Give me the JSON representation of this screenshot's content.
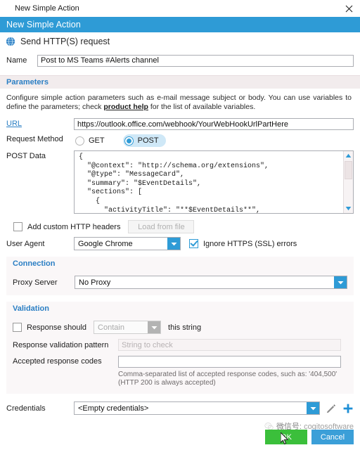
{
  "window": {
    "title": "New Simple Action",
    "close_icon": "close-icon"
  },
  "banner": {
    "title": "New Simple Action"
  },
  "action": {
    "icon": "globe-icon",
    "title": "Send HTTP(S) request"
  },
  "name_field": {
    "label": "Name",
    "value": "Post to MS Teams #Alerts channel"
  },
  "parameters": {
    "header": "Parameters",
    "description_part1": "Configure simple action parameters such as e-mail message subject or body. You can use variables to define the parameters; check ",
    "description_link": "product help",
    "description_part2": " for the list of available variables.",
    "url": {
      "label": "URL",
      "value": "https://outlook.office.com/webhook/YourWebHookUrlPartHere"
    },
    "request_method": {
      "label": "Request Method",
      "options": [
        "GET",
        "POST"
      ],
      "selected": "POST"
    },
    "post_data": {
      "label": "POST Data",
      "value": "{\n  \"@context\": \"http://schema.org/extensions\",\n  \"@type\": \"MessageCard\",\n  \"summary\": \"$EventDetails\",\n  \"sections\": [\n    {\n      \"activityTitle\": \"**$EventDetails**\",",
      "scroll_up_icon": "scroll-up-arrow-icon",
      "scroll_down_icon": "scroll-down-arrow-icon"
    },
    "custom_headers": {
      "label": "Add custom HTTP headers",
      "checked": false,
      "load_button": "Load from file",
      "load_button_enabled": false
    },
    "user_agent": {
      "label": "User Agent",
      "value": "Google Chrome"
    },
    "ignore_ssl": {
      "label": "Ignore HTTPS (SSL) errors",
      "checked": true
    }
  },
  "connection": {
    "header": "Connection",
    "proxy": {
      "label": "Proxy Server",
      "value": "No Proxy"
    }
  },
  "validation": {
    "header": "Validation",
    "response_should": {
      "label": "Response should",
      "checked": false,
      "condition": "Contain",
      "tail": "this string"
    },
    "pattern": {
      "label": "Response validation pattern",
      "placeholder": "String to check",
      "value": ""
    },
    "accepted_codes": {
      "label": "Accepted response codes",
      "value": "",
      "hint": "Comma-separated list of accepted response codes, such as: '404,500' (HTTP 200 is always accepted)"
    }
  },
  "credentials": {
    "label": "Credentials",
    "value": "<Empty credentials>",
    "edit_icon": "pencil-icon",
    "add_icon": "plus-icon"
  },
  "footer": {
    "ok_label": "OK",
    "cancel_label": "Cancel"
  },
  "watermark": {
    "prefix": "微信号:",
    "handle": "cogitosoftware"
  },
  "colors": {
    "banner_blue": "#2e9bd6",
    "section_header_text": "#2b7fc4",
    "section_header_bg": "#f2eced",
    "ok_green": "#3bbf3b",
    "cancel_blue": "#3b9fd8"
  }
}
